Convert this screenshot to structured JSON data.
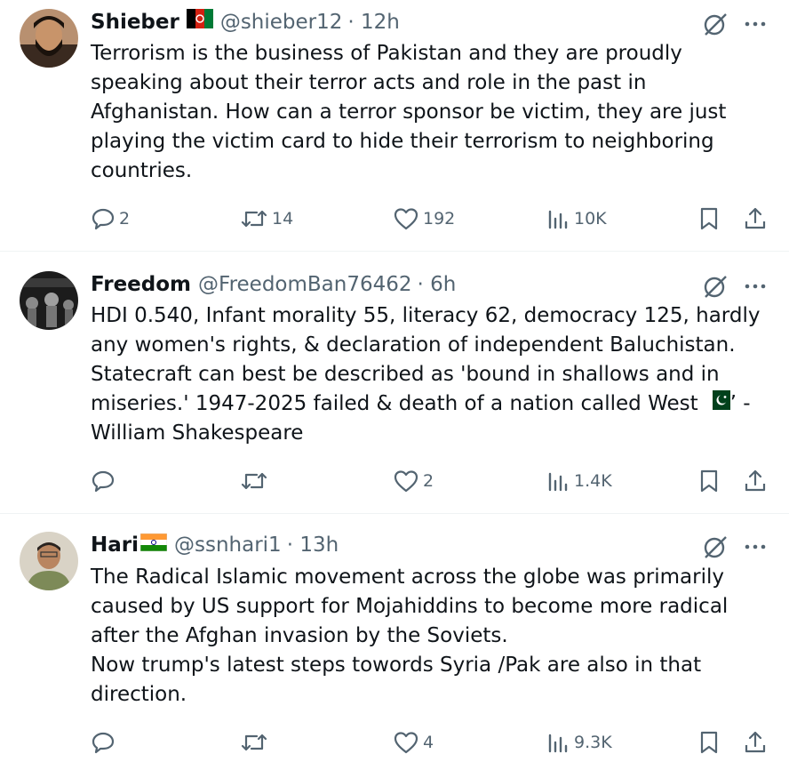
{
  "tweets": [
    {
      "name": "Shieber",
      "flag": "afghanistan-flag",
      "handle": "@shieber12",
      "time": "· 12h",
      "lines": [
        "Terrorism is the business of Pakistan and they are proudly",
        "speaking about their terror acts and role in the past in",
        "Afghanistan. How can a terror sponsor be victim, they are just",
        "playing the victim card to hide their terrorism to neighboring",
        "countries."
      ],
      "replies": "2",
      "reposts": "14",
      "likes": "192",
      "views": "10K"
    },
    {
      "name": "Freedom",
      "handle": "@FreedomBan76462",
      "time": "· 6h",
      "lines": [
        "HDI 0.540, Infant morality 55, literacy  62, democracy 125, hardly",
        "any women's rights,  & declaration of independent Baluchistan.",
        "Statecraft can best be described as 'bound in shallows and in",
        "miseries.' 1947-2025 failed & death of a nation called West",
        "William Shakespeare"
      ],
      "line4_tail": "’ -",
      "inline_flag": "pakistan-flag",
      "replies": "",
      "reposts": "",
      "likes": "2",
      "views": "1.4K"
    },
    {
      "name": "Hari",
      "flag": "india-flag",
      "handle": "@ssnhari1",
      "time": "· 13h",
      "lines": [
        "The Radical Islamic movement across the globe was primarily",
        "caused by US support for Mojahiddins to become more radical",
        "after the Afghan invasion by the Soviets.",
        "Now trump's latest steps towords Syria /Pak are also in that",
        "direction."
      ],
      "replies": "",
      "reposts": "",
      "likes": "4",
      "views": "9.3K"
    }
  ],
  "colors": {
    "text": "#0f1419",
    "secondary": "#536471",
    "divider": "#eff3f4"
  },
  "icons": [
    "reply-icon",
    "repost-icon",
    "like-icon",
    "views-icon",
    "bookmark-icon",
    "share-icon",
    "grok-icon",
    "more-icon"
  ]
}
